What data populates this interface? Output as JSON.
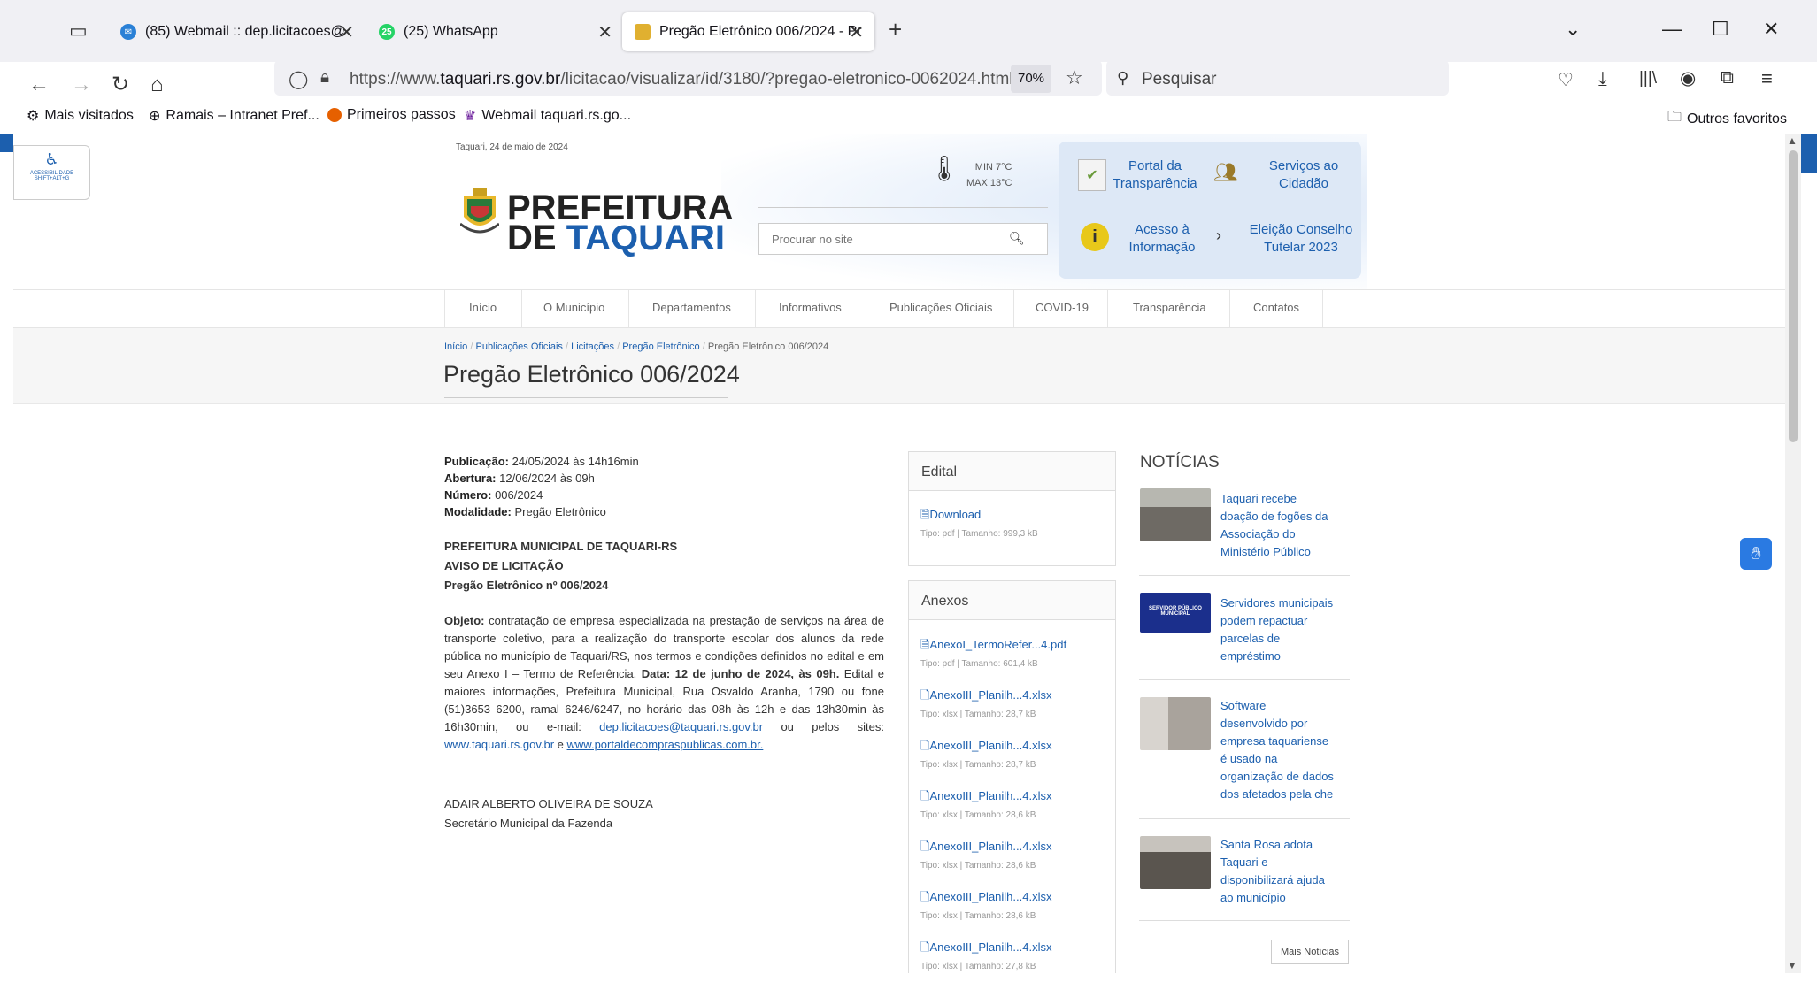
{
  "browser": {
    "tabs": [
      {
        "title": "(85) Webmail :: dep.licitacoes@",
        "icon": "webmail-icon"
      },
      {
        "title": "(25) WhatsApp",
        "badge": "25",
        "icon": "whatsapp-icon"
      },
      {
        "title": "Pregão Eletrônico 006/2024 - Pr",
        "icon": "taquari-icon"
      }
    ],
    "url_prefix": "https://www.",
    "url_host": "taquari.rs.gov.br",
    "url_path": "/licitacao/visualizar/id/3180/?pregao-eletronico-0062024.html",
    "zoom": "70%",
    "search_placeholder": "Pesquisar",
    "bookmarks": [
      "Mais visitados",
      "Ramais – Intranet Pref...",
      "Primeiros passos",
      "Webmail taquari.rs.go..."
    ],
    "other_bookmarks": "Outros favoritos"
  },
  "site": {
    "date": "Taquari, 24 de maio de 2024",
    "accessibility": {
      "line1": "ACESSIBILIDADE",
      "line2": "SHIFT+ALT+G"
    },
    "logo": {
      "line1": "PREFEITURA",
      "line2_a": "DE",
      "line2_b": "TAQUARI"
    },
    "weather": {
      "min": "MIN 7°C",
      "max": "MAX 13°C"
    },
    "search_placeholder": "Procurar no site",
    "quick_links": [
      {
        "line1": "Portal da",
        "line2": "Transparência"
      },
      {
        "line1": "Serviços ao",
        "line2": "Cidadão"
      },
      {
        "line1": "Acesso à",
        "line2": "Informação"
      },
      {
        "line1": "Eleição Conselho",
        "line2": "Tutelar 2023"
      }
    ],
    "menu": [
      "Início",
      "O Município",
      "Departamentos",
      "Informativos",
      "Publicações Oficiais",
      "COVID-19",
      "Transparência",
      "Contatos"
    ],
    "breadcrumb": [
      "Início",
      "Publicações Oficiais",
      "Licitações",
      "Pregão Eletrônico",
      "Pregão Eletrônico 006/2024"
    ],
    "page_title": "Pregão Eletrônico 006/2024"
  },
  "content": {
    "meta": [
      {
        "label": "Publicação:",
        "value": "24/05/2024 às 14h16min"
      },
      {
        "label": "Abertura:",
        "value": "12/06/2024 às 09h"
      },
      {
        "label": "Número:",
        "value": "006/2024"
      },
      {
        "label": "Modalidade:",
        "value": "Pregão Eletrônico"
      }
    ],
    "heading1": "PREFEITURA MUNICIPAL DE TAQUARI-RS",
    "heading2": "AVISO DE LICITAÇÃO",
    "heading3": "Pregão Eletrônico nº 006/2024",
    "objeto_label": "Objeto:",
    "objeto_text": "contratação de empresa especializada na prestação de serviços na área de transporte coletivo, para a realização do transporte escolar dos alunos da rede pública no município de Taquari/RS, nos termos e condições definidos no edital e em seu Anexo I – Termo de Referência.",
    "data_label": "Data: 12 de junho de 2024, às 09h.",
    "rest_text": "Edital e maiores informações, Prefeitura Municipal, Rua Osvaldo Aranha, 1790 ou fone (51)3653 6200, ramal 6246/6247, no horário das 08h às 12h e das 13h30min às 16h30min, ou e-mail:",
    "email": "dep.licitacoes@taquari.rs.gov.br",
    "sites_text": "ou pelos sites:",
    "site1": "www.taquari.rs.gov.br",
    "and_text": "e",
    "site2": "www.portaldecompraspublicas.com.br.",
    "signer_name": "ADAIR ALBERTO OLIVEIRA DE SOUZA",
    "signer_role": "Secretário Municipal da Fazenda"
  },
  "edital": {
    "title": "Edital",
    "file": {
      "name": "Download",
      "meta": "Tipo: pdf  |  Tamanho: 999,3 kB"
    }
  },
  "anexos": {
    "title": "Anexos",
    "files": [
      {
        "name": "AnexoI_TermoRefer...4.pdf",
        "meta": "Tipo: pdf  |  Tamanho: 601,4 kB"
      },
      {
        "name": "AnexoIII_Planilh...4.xlsx",
        "meta": "Tipo: xlsx  |  Tamanho: 28,7 kB"
      },
      {
        "name": "AnexoIII_Planilh...4.xlsx",
        "meta": "Tipo: xlsx  |  Tamanho: 28,7 kB"
      },
      {
        "name": "AnexoIII_Planilh...4.xlsx",
        "meta": "Tipo: xlsx  |  Tamanho: 28,6 kB"
      },
      {
        "name": "AnexoIII_Planilh...4.xlsx",
        "meta": "Tipo: xlsx  |  Tamanho: 28,6 kB"
      },
      {
        "name": "AnexoIII_Planilh...4.xlsx",
        "meta": "Tipo: xlsx  |  Tamanho: 28,6 kB"
      },
      {
        "name": "AnexoIII_Planilh...4.xlsx",
        "meta": "Tipo: xlsx  |  Tamanho: 27,8 kB"
      }
    ]
  },
  "news": {
    "title": "NOTÍCIAS",
    "items": [
      "Taquari recebe doação de fogões da Associação do Ministério Público",
      "Servidores municipais podem repactuar parcelas de empréstimo",
      "Software desenvolvido por empresa taquariense é usado na organização de dados dos afetados pela che",
      "Santa Rosa adota Taquari e disponibilizará ajuda ao município"
    ],
    "thumb2_text": "SERVIDOR PÚBLICO MUNICIPAL",
    "more": "Mais Notícias"
  },
  "colors": {
    "brand_blue": "#1c5fae",
    "link_blue": "#1c5fae"
  }
}
